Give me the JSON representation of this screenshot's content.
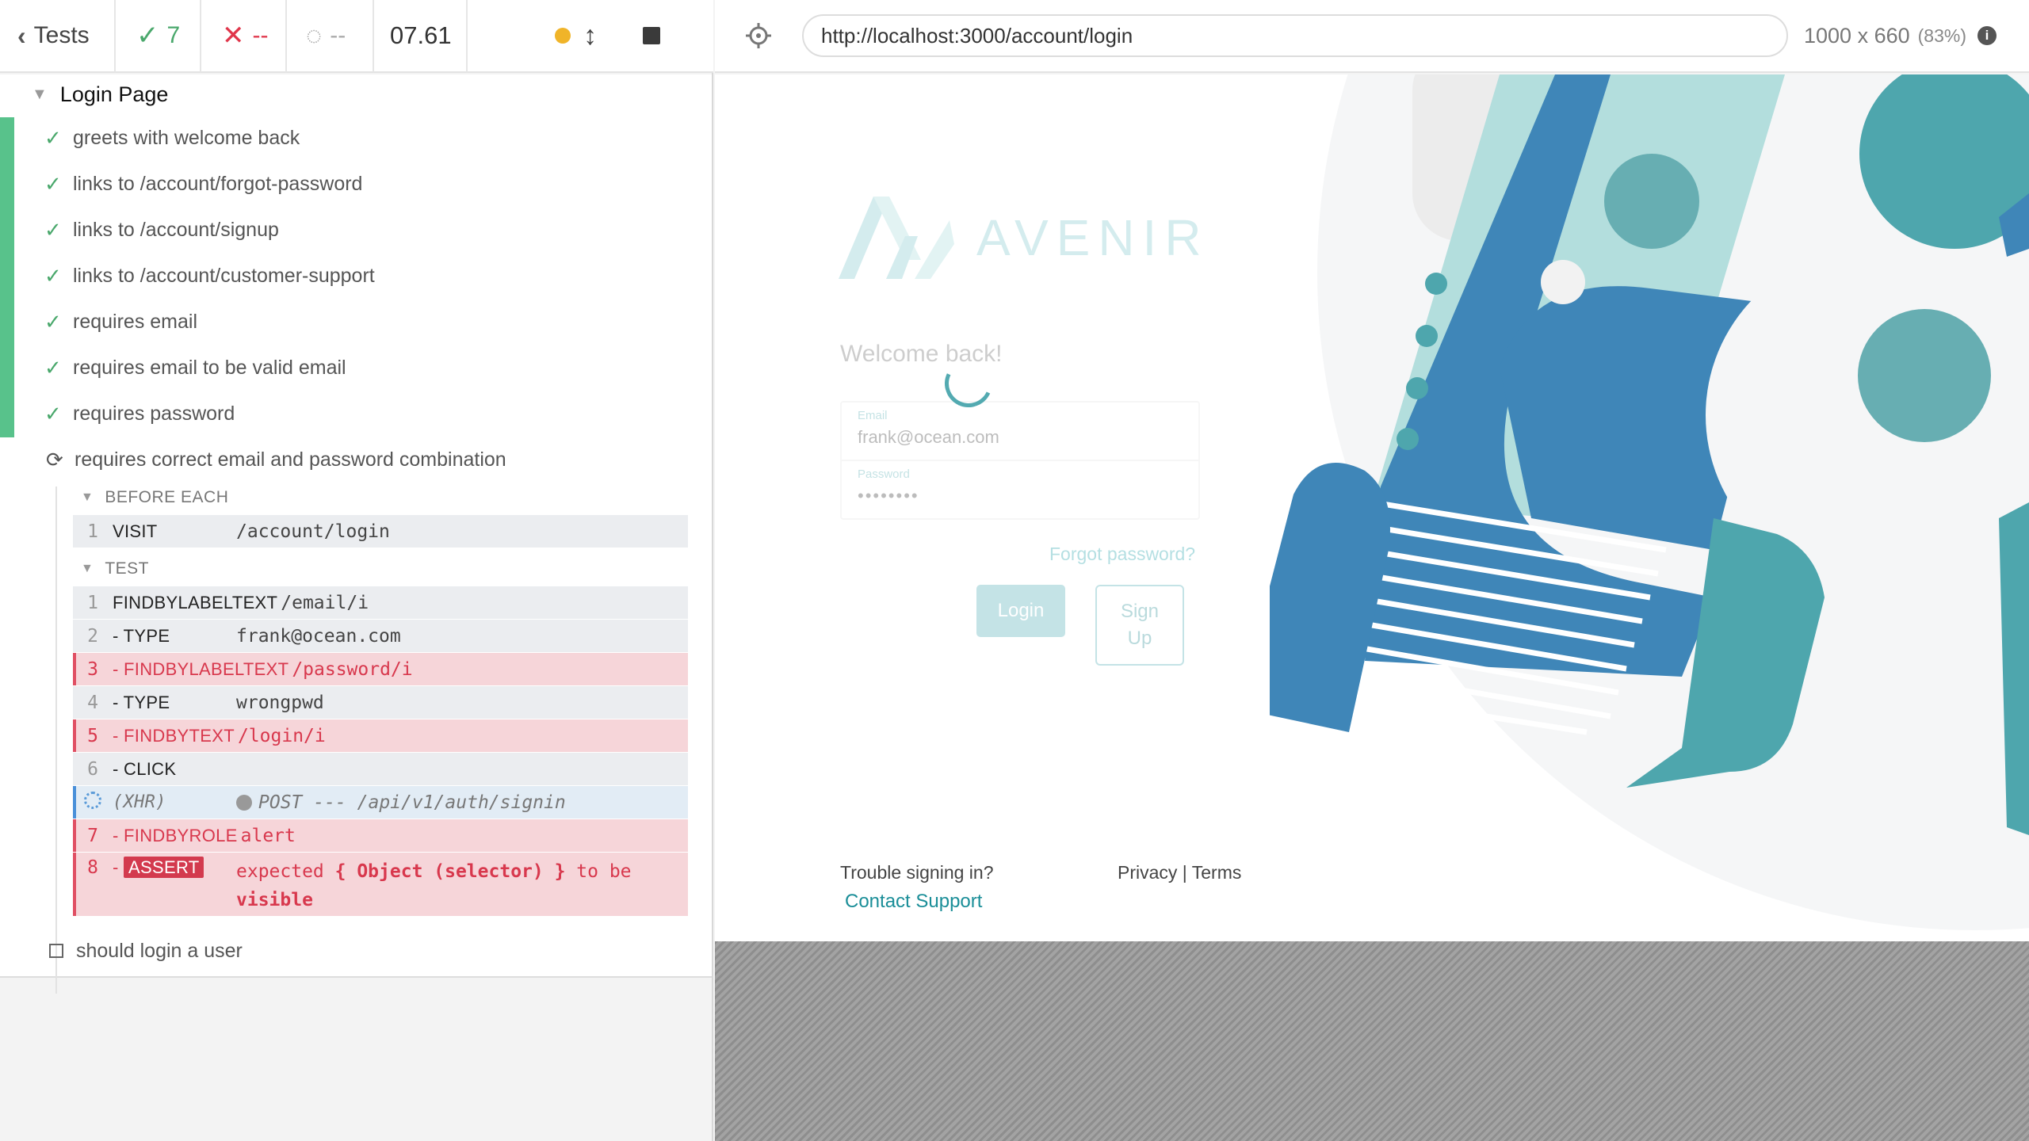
{
  "reporter": {
    "back_label": "Tests",
    "passed": "7",
    "failed": "--",
    "pending": "--",
    "duration": "07.61",
    "suite_title": "Login Page",
    "tests": [
      "greets with welcome back",
      "links to /account/forgot-password",
      "links to /account/signup",
      "links to /account/customer-support",
      "requires email",
      "requires email to be valid email",
      "requires password"
    ],
    "running_test": "requires correct email and password combination",
    "pending_test": "should login a user",
    "before_each_title": "BEFORE EACH",
    "test_title": "TEST",
    "before_each_commands": [
      {
        "num": "1",
        "name": "VISIT",
        "msg": "/account/login"
      }
    ],
    "commands": [
      {
        "num": "1",
        "name": "FINDBYLABELTEXT",
        "msg": "/email/i"
      },
      {
        "num": "2",
        "name": "TYPE",
        "msg": "frank@ocean.com"
      },
      {
        "num": "3",
        "name": "FINDBYLABELTEXT",
        "msg": "/password/i"
      },
      {
        "num": "4",
        "name": "TYPE",
        "msg": "wrongpwd"
      },
      {
        "num": "5",
        "name": "FINDBYTEXT",
        "msg": "/login/i"
      },
      {
        "num": "6",
        "name": "CLICK",
        "msg": ""
      },
      {
        "num": "",
        "name": "(XHR)",
        "msg": "POST --- /api/v1/auth/signin"
      },
      {
        "num": "7",
        "name": "FINDBYROLE",
        "msg": "alert"
      },
      {
        "num": "8",
        "name": "ASSERT",
        "msg_a": "expected",
        "msg_b": "{ Object (selector) }",
        "msg_c": "to be",
        "msg_d": "visible"
      }
    ]
  },
  "aut": {
    "url": "http://localhost:3000/account/login",
    "viewport": "1000 x 660",
    "scale": "(83%)"
  },
  "app": {
    "brand": "AVENIR",
    "welcome": "Welcome back!",
    "email_label": "Email",
    "email_value": "frank@ocean.com",
    "password_label": "Password",
    "password_value": "••••••••",
    "forgot": "Forgot password?",
    "login": "Login",
    "signup_1": "Sign",
    "signup_2": "Up",
    "trouble": "Trouble signing in?",
    "contact": "Contact Support",
    "footer": "Privacy | Terms"
  },
  "colors": {
    "pass": "#4aa86c",
    "fail": "#e0364b",
    "teal": "#4aa6ad",
    "blue": "#3f86b8"
  }
}
